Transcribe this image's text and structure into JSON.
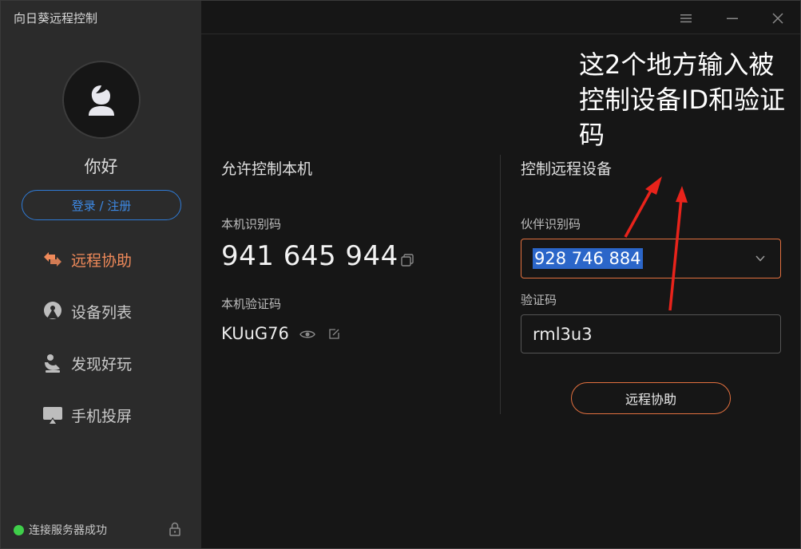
{
  "app": {
    "title": "向日葵远程控制"
  },
  "sidebar": {
    "greeting": "你好",
    "login_button": "登录 / 注册",
    "nav": [
      {
        "label": "远程协助",
        "icon": "remote-assist-icon",
        "active": true
      },
      {
        "label": "设备列表",
        "icon": "device-list-icon",
        "active": false
      },
      {
        "label": "发现好玩",
        "icon": "discover-icon",
        "active": false
      },
      {
        "label": "手机投屏",
        "icon": "screen-cast-icon",
        "active": false
      }
    ],
    "status": "连接服务器成功"
  },
  "allow_control": {
    "title": "允许控制本机",
    "id_label": "本机识别码",
    "id_value": "941 645 944",
    "code_label": "本机验证码",
    "code_value": "KUuG76"
  },
  "remote_control": {
    "title": "控制远程设备",
    "partner_label": "伙伴识别码",
    "partner_value": "928 746 884",
    "code_label": "验证码",
    "code_value": "rml3u3",
    "connect_button": "远程协助"
  },
  "annotation": {
    "text": "这2个地方输入被控制设备ID和验证码"
  },
  "colors": {
    "accent": "#e2703f",
    "link_blue": "#2f7bd6",
    "status_green": "#3fcf4a",
    "selection": "#2b66c9",
    "arrow_red": "#e8231b"
  }
}
